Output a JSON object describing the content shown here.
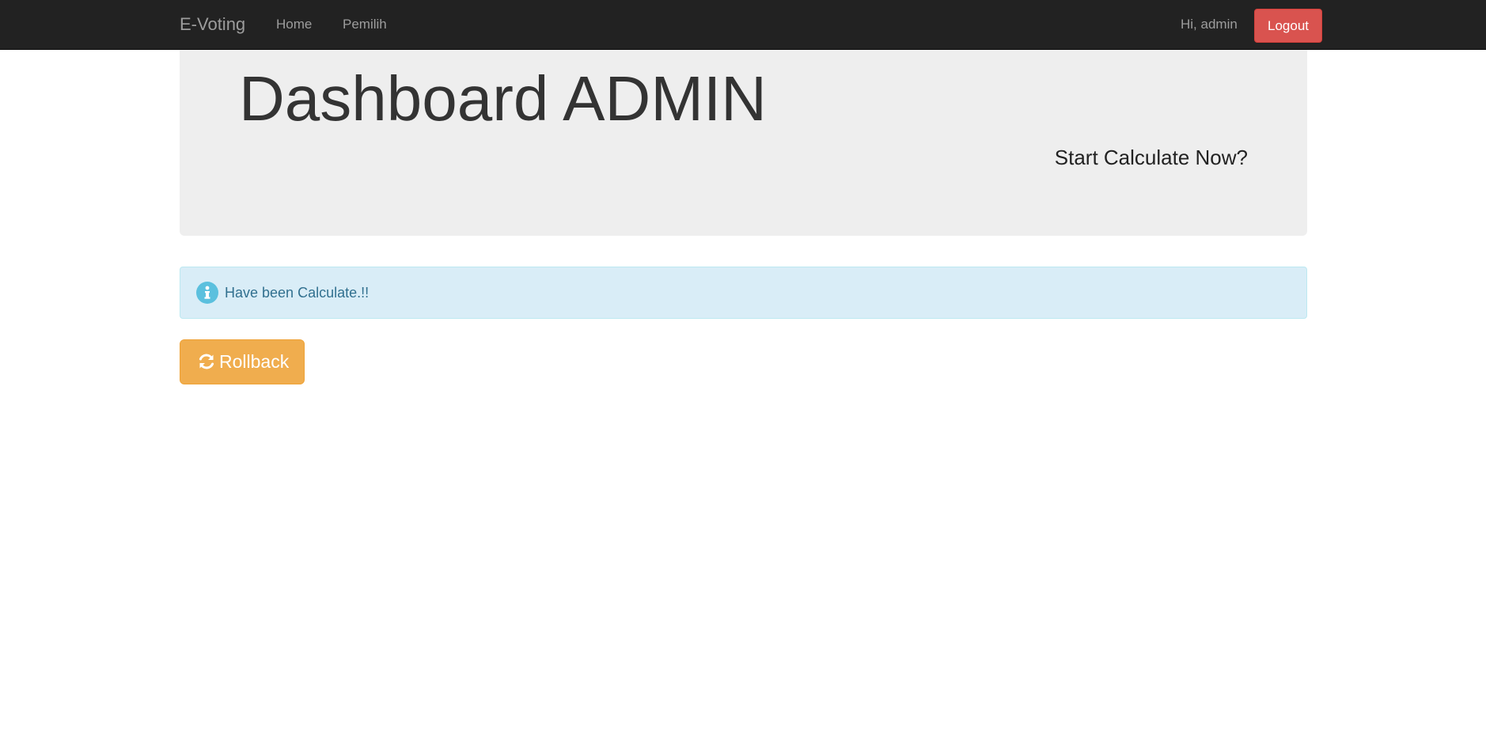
{
  "navbar": {
    "brand": "E-Voting",
    "links": [
      {
        "label": "Home"
      },
      {
        "label": "Pemilih"
      }
    ],
    "greeting": "Hi, admin",
    "logout_label": "Logout"
  },
  "jumbotron": {
    "title": "Dashboard ADMIN",
    "calculate_link": "Start Calculate Now?"
  },
  "alert": {
    "icon": "info-circle-icon",
    "message": "Have been Calculate.!!"
  },
  "rollback": {
    "icon": "refresh-icon",
    "label": "Rollback"
  },
  "colors": {
    "navbar_bg": "#222222",
    "logout_bg": "#d9534f",
    "jumbotron_bg": "#eeeeee",
    "alert_bg": "#d9edf7",
    "alert_text": "#31708f",
    "info_icon": "#5bc0de",
    "rollback_bg": "#f0ad4e"
  }
}
